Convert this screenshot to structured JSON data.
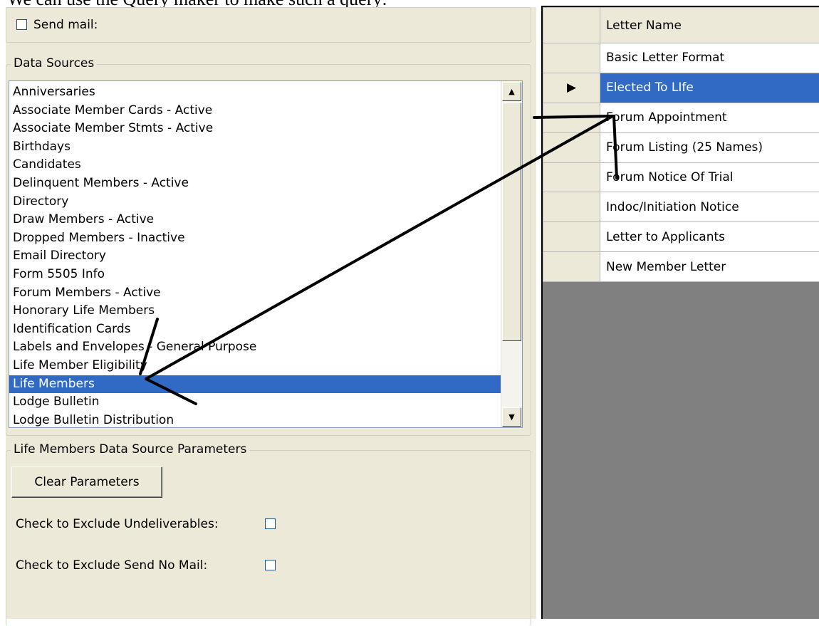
{
  "document": {
    "caption": "We can use the Query maker to make such a query:"
  },
  "send_mail": {
    "label": "Send mail:",
    "checked": false
  },
  "data_sources": {
    "legend": "Data Sources",
    "items": [
      "Anniversaries",
      "Associate Member Cards - Active",
      "Associate Member Stmts - Active",
      "Birthdays",
      "Candidates",
      "Delinquent Members - Active",
      "Directory",
      "Draw Members - Active",
      "Dropped Members - Inactive",
      "Email Directory",
      "Form 5505 Info",
      "Forum Members - Active",
      "Honorary Life Members",
      "Identification Cards",
      "Labels and Envelopes - General Purpose",
      "Life Member Eligibility",
      "Life Members",
      "Lodge Bulletin",
      "Lodge Bulletin Distribution"
    ],
    "selected": "Life Members"
  },
  "parameters": {
    "legend": "Life Members Data Source Parameters",
    "clear_button": "Clear Parameters",
    "exclude_undeliverables_label": "Check to Exclude Undeliverables:",
    "exclude_send_no_mail_label": "Check to Exclude Send No Mail:"
  },
  "letters": {
    "header": "Letter Name",
    "rows": [
      "Basic Letter Format",
      "Elected To LIfe",
      "Forum Appointment",
      "Forum Listing (25 Names)",
      "Forum Notice Of Trial",
      "Indoc/Initiation Notice",
      "Letter to Applicants",
      "New Member Letter"
    ],
    "selected": "Elected To LIfe",
    "current_row_marker": "▶"
  },
  "colors": {
    "selection": "#316ac5",
    "panel": "#ece9d8",
    "grid_empty": "#808080"
  }
}
